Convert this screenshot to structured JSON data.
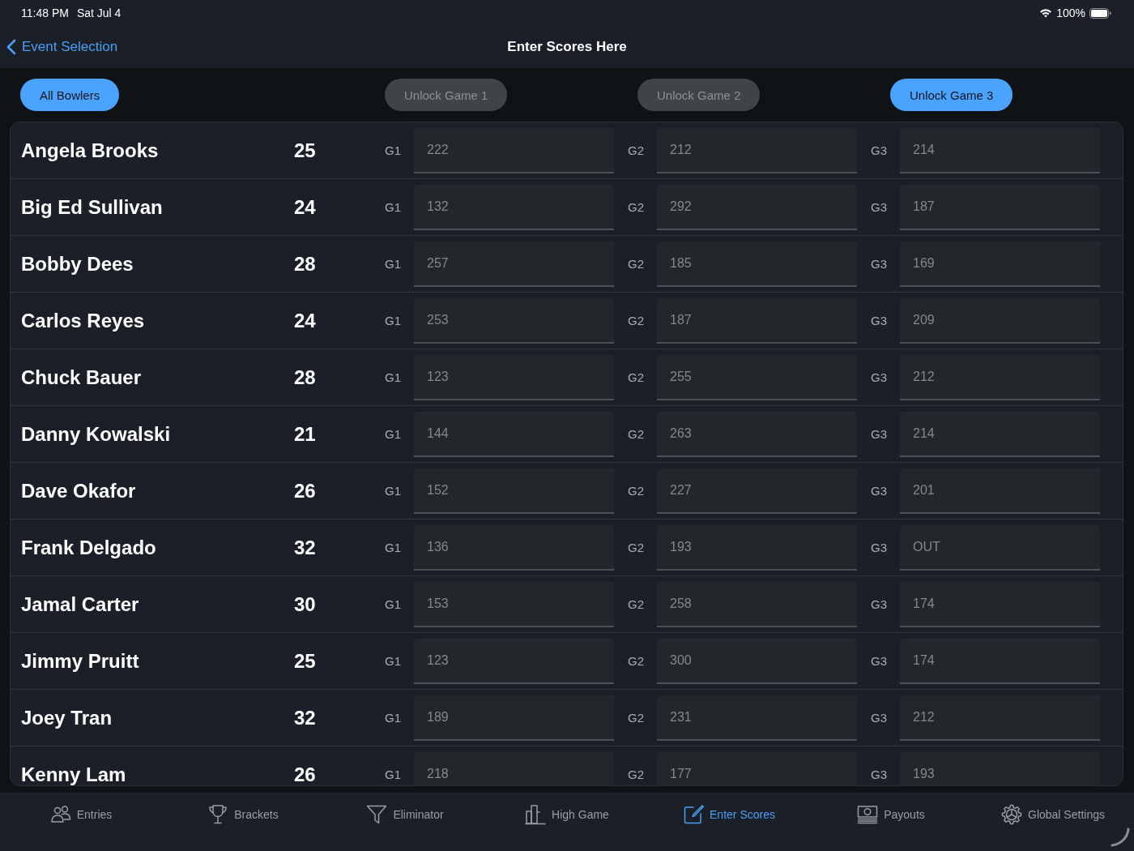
{
  "status_bar": {
    "time": "11:48 PM",
    "date": "Sat Jul 4",
    "battery": "100%"
  },
  "nav_bar": {
    "back": "Event Selection",
    "title": "Enter Scores Here"
  },
  "toolbar": {
    "buttons": [
      {
        "label": "All Bowlers",
        "active": true
      },
      {
        "label": "Unlock Game 1",
        "active": false
      },
      {
        "label": "Unlock Game 2",
        "active": false
      },
      {
        "label": "Unlock Game 3",
        "active": true
      }
    ]
  },
  "bowlers": [
    {
      "name": "Angela Brooks",
      "number": "25",
      "games": [
        {
          "label": "G1",
          "score": "222"
        },
        {
          "label": "G2",
          "score": "212"
        },
        {
          "label": "G3",
          "score": "214"
        }
      ]
    },
    {
      "name": "Big Ed Sullivan",
      "number": "24",
      "games": [
        {
          "label": "G1",
          "score": "132"
        },
        {
          "label": "G2",
          "score": "292"
        },
        {
          "label": "G3",
          "score": "187"
        }
      ]
    },
    {
      "name": "Bobby Dees",
      "number": "28",
      "games": [
        {
          "label": "G1",
          "score": "257"
        },
        {
          "label": "G2",
          "score": "185"
        },
        {
          "label": "G3",
          "score": "169"
        }
      ]
    },
    {
      "name": "Carlos Reyes",
      "number": "24",
      "games": [
        {
          "label": "G1",
          "score": "253"
        },
        {
          "label": "G2",
          "score": "187"
        },
        {
          "label": "G3",
          "score": "209"
        }
      ]
    },
    {
      "name": "Chuck Bauer",
      "number": "28",
      "games": [
        {
          "label": "G1",
          "score": "123"
        },
        {
          "label": "G2",
          "score": "255"
        },
        {
          "label": "G3",
          "score": "212"
        }
      ]
    },
    {
      "name": "Danny Kowalski",
      "number": "21",
      "games": [
        {
          "label": "G1",
          "score": "144"
        },
        {
          "label": "G2",
          "score": "263"
        },
        {
          "label": "G3",
          "score": "214"
        }
      ]
    },
    {
      "name": "Dave Okafor",
      "number": "26",
      "games": [
        {
          "label": "G1",
          "score": "152"
        },
        {
          "label": "G2",
          "score": "227"
        },
        {
          "label": "G3",
          "score": "201"
        }
      ]
    },
    {
      "name": "Frank Delgado",
      "number": "32",
      "games": [
        {
          "label": "G1",
          "score": "136"
        },
        {
          "label": "G2",
          "score": "193"
        },
        {
          "label": "G3",
          "score": "OUT"
        }
      ]
    },
    {
      "name": "Jamal Carter",
      "number": "30",
      "games": [
        {
          "label": "G1",
          "score": "153"
        },
        {
          "label": "G2",
          "score": "258"
        },
        {
          "label": "G3",
          "score": "174"
        }
      ]
    },
    {
      "name": "Jimmy Pruitt",
      "number": "25",
      "games": [
        {
          "label": "G1",
          "score": "123"
        },
        {
          "label": "G2",
          "score": "300"
        },
        {
          "label": "G3",
          "score": "174"
        }
      ]
    },
    {
      "name": "Joey Tran",
      "number": "32",
      "games": [
        {
          "label": "G1",
          "score": "189"
        },
        {
          "label": "G2",
          "score": "231"
        },
        {
          "label": "G3",
          "score": "212"
        }
      ]
    },
    {
      "name": "Kenny Lam",
      "number": "26",
      "games": [
        {
          "label": "G1",
          "score": "218"
        },
        {
          "label": "G2",
          "score": "177"
        },
        {
          "label": "G3",
          "score": "193"
        }
      ]
    }
  ],
  "tab_bar": {
    "items": [
      {
        "label": "Entries",
        "selected": false
      },
      {
        "label": "Brackets",
        "selected": false
      },
      {
        "label": "Eliminator",
        "selected": false
      },
      {
        "label": "High Game",
        "selected": false
      },
      {
        "label": "Enter Scores",
        "selected": true
      },
      {
        "label": "Payouts",
        "selected": false
      },
      {
        "label": "Global Settings",
        "selected": false
      }
    ]
  }
}
